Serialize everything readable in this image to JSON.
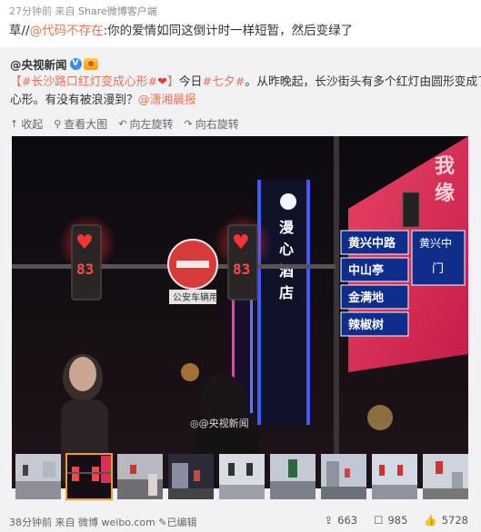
{
  "post": {
    "time": "27分钟前",
    "from_prefix": "来自",
    "source": "Share微博客户端",
    "comment_prefix": "草//",
    "comment_mention": "@代码不存在",
    "comment_body": ":你的爱情如同这倒计时一样短暂，然后变绿了"
  },
  "original": {
    "author": "@央视新闻",
    "verified_mark": "V",
    "line1_topic": "【#长沙路口红灯变成心形#",
    "line1_heart": "❤",
    "line1_close": "】",
    "line1_rest": "今日",
    "line1_topic2": "#七夕#",
    "line1_end": "。从昨晚起，长沙街头有多个红灯由圆形变成了",
    "line2_start": "心形。有没有被浪漫到？",
    "line2_mention": "@潇湘晨报",
    "toolbar": {
      "collapse": "收起",
      "view_large": "查看大图",
      "rotate_left": "向左旋转",
      "rotate_right": "向右旋转"
    },
    "photo": {
      "signal_left": "83",
      "signal_right": "83",
      "sign": "公安车辆用",
      "building_sign": "漫心酒店",
      "road_signs": [
        "黄兴中路",
        "中山亭",
        "金满地",
        "辣椒树"
      ],
      "watermark": "@央视新闻"
    },
    "thumbnail_count": 9,
    "active_thumbnail": 2
  },
  "footer": {
    "time": "38分钟前",
    "from_prefix": "来自",
    "source": "微博 weibo.com",
    "edited": "已编辑",
    "reposts": "663",
    "comments": "985",
    "likes": "5728"
  },
  "colors": {
    "accent_link": "#eb7350",
    "blue_link": "#3d79c2",
    "repost_bg": "#f2f2f5",
    "active_thumb": "#f29a2e"
  }
}
